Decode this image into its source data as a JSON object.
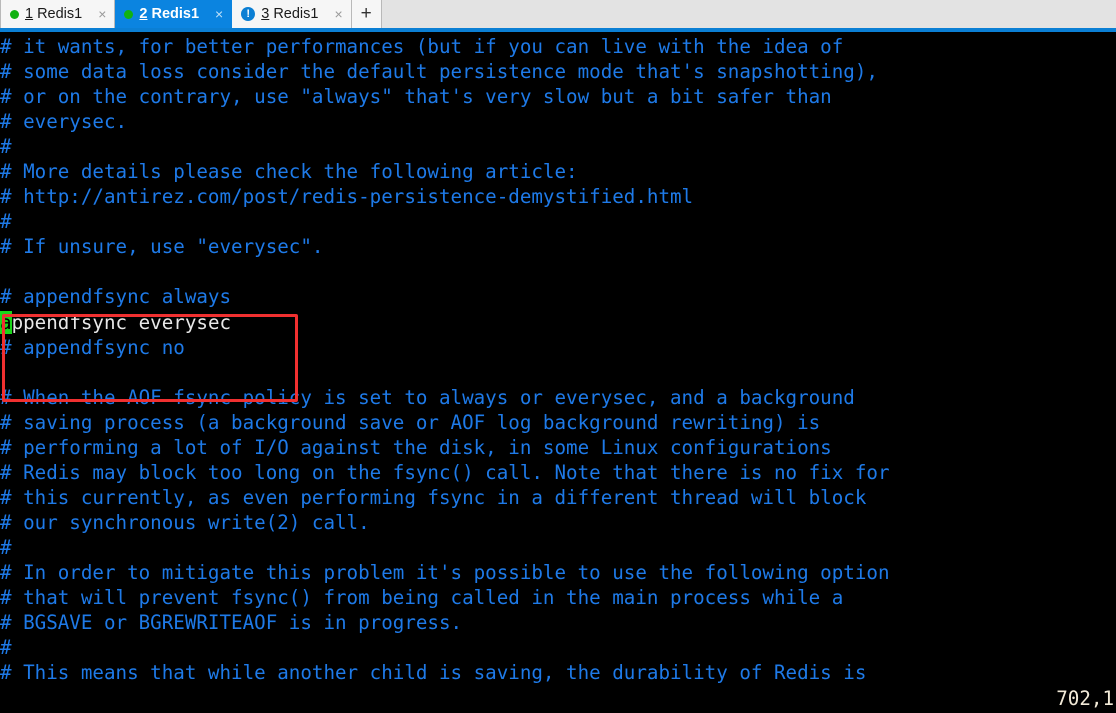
{
  "window": {
    "app": "terminal-emulator",
    "accent_color": "#0b84e0",
    "background_color": "#000000",
    "comment_color": "#1e7ae8",
    "text_color": "#e8e8e8",
    "cursor_color": "#19d619",
    "annotation_color": "#f03030"
  },
  "tabbar": {
    "new_tab_label": "+",
    "close_label": "×",
    "tabs": [
      {
        "index": "1",
        "title": "Redis1",
        "icon": "green-dot",
        "active": false,
        "close": "×"
      },
      {
        "index": "2",
        "title": "Redis1",
        "icon": "green-dot",
        "active": true,
        "close": "×"
      },
      {
        "index": "3",
        "title": "Redis1",
        "icon": "alert-badge",
        "alert_glyph": "!",
        "active": false,
        "close": "×"
      }
    ]
  },
  "terminal": {
    "lines": [
      {
        "text": "# it wants, for better performances (but if you can live with the idea of",
        "style": "comment"
      },
      {
        "text": "# some data loss consider the default persistence mode that's snapshotting),",
        "style": "comment"
      },
      {
        "text": "# or on the contrary, use \"always\" that's very slow but a bit safer than",
        "style": "comment"
      },
      {
        "text": "# everysec.",
        "style": "comment"
      },
      {
        "text": "#",
        "style": "comment"
      },
      {
        "text": "# More details please check the following article:",
        "style": "comment"
      },
      {
        "text": "# http://antirez.com/post/redis-persistence-demystified.html",
        "style": "comment"
      },
      {
        "text": "#",
        "style": "comment"
      },
      {
        "text": "# If unsure, use \"everysec\".",
        "style": "comment"
      },
      {
        "text": "",
        "style": "comment"
      },
      {
        "text": "# appendfsync always",
        "style": "comment"
      },
      {
        "text": "appendfsync everysec",
        "style": "plain",
        "cursor_at": 0
      },
      {
        "text": "# appendfsync no",
        "style": "comment"
      },
      {
        "text": "",
        "style": "comment"
      },
      {
        "text": "# When the AOF fsync policy is set to always or everysec, and a background",
        "style": "comment"
      },
      {
        "text": "# saving process (a background save or AOF log background rewriting) is",
        "style": "comment"
      },
      {
        "text": "# performing a lot of I/O against the disk, in some Linux configurations",
        "style": "comment"
      },
      {
        "text": "# Redis may block too long on the fsync() call. Note that there is no fix for",
        "style": "comment"
      },
      {
        "text": "# this currently, as even performing fsync in a different thread will block",
        "style": "comment"
      },
      {
        "text": "# our synchronous write(2) call.",
        "style": "comment"
      },
      {
        "text": "#",
        "style": "comment"
      },
      {
        "text": "# In order to mitigate this problem it's possible to use the following option",
        "style": "comment"
      },
      {
        "text": "# that will prevent fsync() from being called in the main process while a",
        "style": "comment"
      },
      {
        "text": "# BGSAVE or BGREWRITEAOF is in progress.",
        "style": "comment"
      },
      {
        "text": "#",
        "style": "comment"
      },
      {
        "text": "# This means that while another child is saving, the durability of Redis is",
        "style": "comment"
      }
    ]
  },
  "status": {
    "cursor_position": "702,1"
  },
  "annotation": {
    "label": "appendfsync-options-highlight",
    "color": "#f03030"
  }
}
